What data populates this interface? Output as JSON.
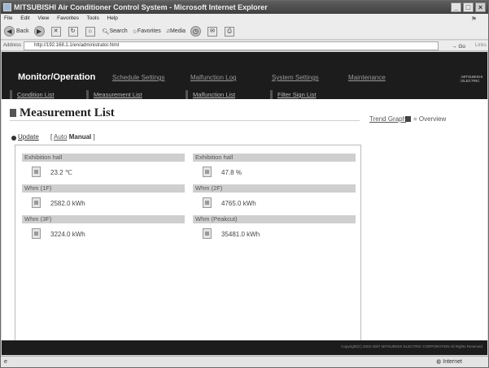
{
  "window": {
    "title": "MITSUBISHI Air Conditioner Control System - Microsoft Internet Explorer",
    "minimize": "_",
    "maximize": "□",
    "close": "×"
  },
  "menu": [
    "File",
    "Edit",
    "View",
    "Favorites",
    "Tools",
    "Help"
  ],
  "toolbar": {
    "back": "Back",
    "search": "Search",
    "favorites": "Favorites",
    "media": "Media"
  },
  "address": {
    "label": "Address",
    "url": "http://192.168.1.1/en/administrator.html",
    "go": "Go",
    "links": "Links"
  },
  "header": {
    "brand": "Monitor/Operation",
    "tabs": [
      "Schedule Settings",
      "Malfunction Log",
      "System Settings",
      "Maintenance"
    ],
    "logo": "MITSUBISHI ELECTRIC"
  },
  "subnav": [
    "Condition List",
    "Measurement List",
    "Malfunction List",
    "Filter Sign List"
  ],
  "page": {
    "title": "Measurement List",
    "trend_link": "Trend Graph",
    "overview": "Overview",
    "update": "Update",
    "auto": "Auto",
    "manual": "Manual"
  },
  "measurements": [
    {
      "label": "Exhibition hall",
      "value": "23.2",
      "unit": "℃",
      "icon": "thermometer-icon"
    },
    {
      "label": "Exhibition hall",
      "value": "47.8",
      "unit": "%",
      "icon": "humidity-icon"
    },
    {
      "label": "Whm (1F)",
      "value": "2582.0",
      "unit": "kWh",
      "icon": "meter-icon"
    },
    {
      "label": "Whm (2F)",
      "value": "4765.0",
      "unit": "kWh",
      "icon": "meter-icon"
    },
    {
      "label": "Whm (3F)",
      "value": "3224.0",
      "unit": "kWh",
      "icon": "meter-icon"
    },
    {
      "label": "Whm (Peakcut)",
      "value": "35481.0",
      "unit": "kWh",
      "icon": "meter-icon"
    }
  ],
  "footer": {
    "copyright": "Copyright(C) 2002-2007 MITSUBISHI ELECTRIC CORPORATION All Rights Reserved"
  },
  "status": {
    "zone": "Internet"
  }
}
